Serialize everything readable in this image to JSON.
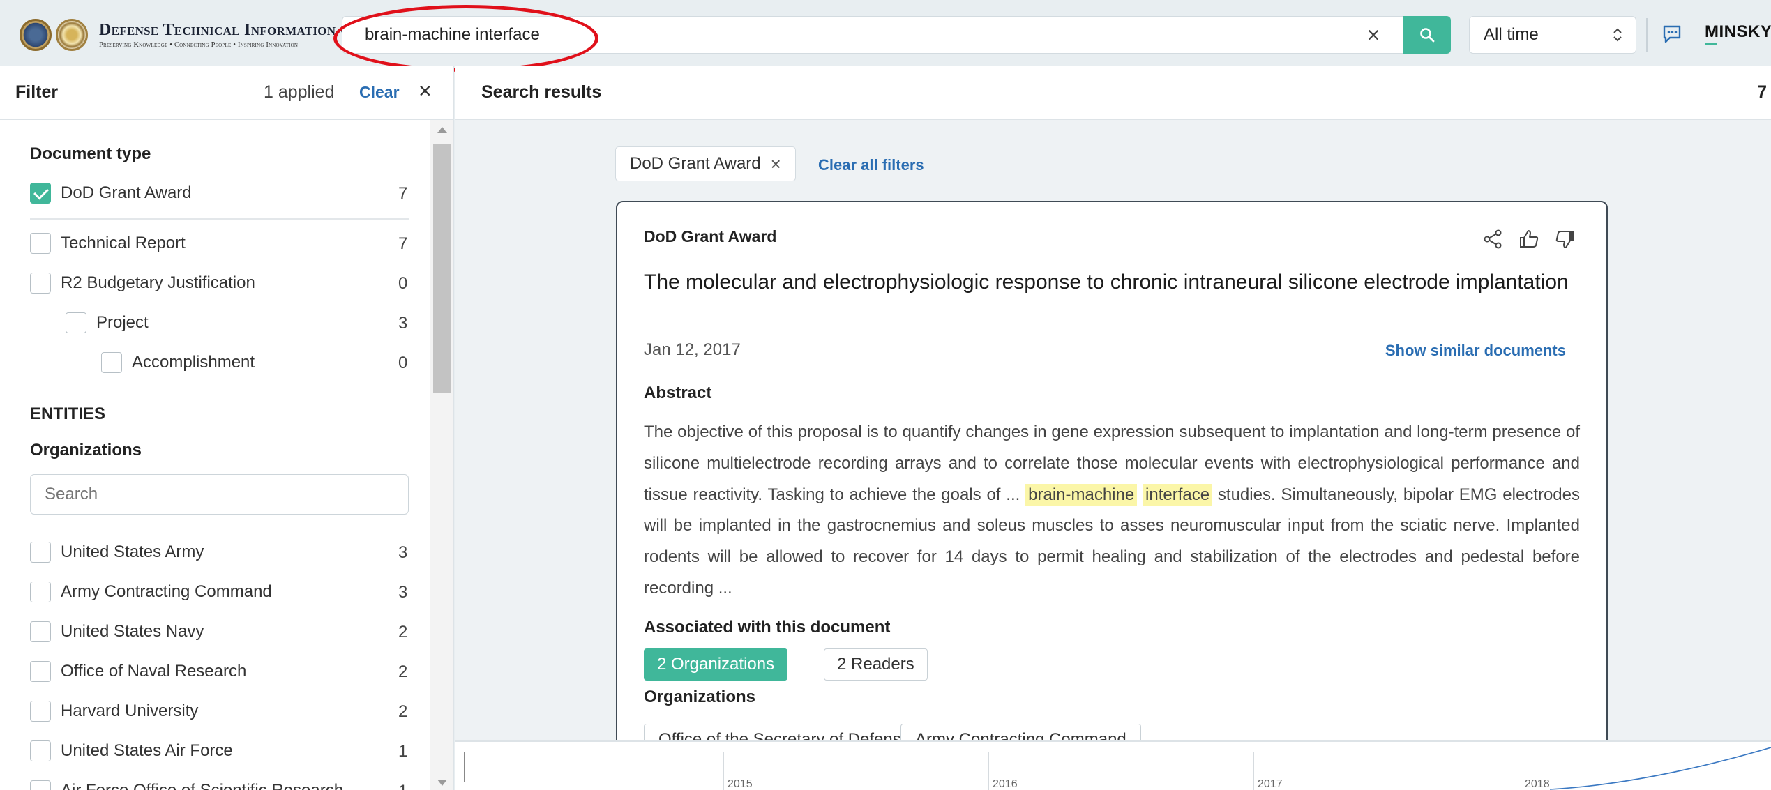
{
  "header": {
    "logo_title": "Defense Technical Information Center",
    "logo_subtitle": "Preserving Knowledge • Connecting People • Inspiring Innovation",
    "search_value": "brain-machine interface",
    "time_filter": "All time",
    "brand": "MINSKY",
    "accent_color": "#40b79a",
    "highlight_color": "#e0101a"
  },
  "filter": {
    "title": "Filter",
    "applied": "1 applied",
    "clear_label": "Clear",
    "document_type_title": "Document type",
    "document_types": [
      {
        "label": "DoD Grant Award",
        "count": "7",
        "checked": true
      },
      {
        "label": "Technical Report",
        "count": "7",
        "checked": false
      },
      {
        "label": "R2 Budgetary Justification",
        "count": "0",
        "checked": false
      },
      {
        "label": "Project",
        "count": "3",
        "checked": false
      },
      {
        "label": "Accomplishment",
        "count": "0",
        "checked": false
      }
    ],
    "entities_title": "ENTITIES",
    "organizations_title": "Organizations",
    "org_search_placeholder": "Search",
    "organizations": [
      {
        "label": "United States Army",
        "count": "3"
      },
      {
        "label": "Army Contracting Command",
        "count": "3"
      },
      {
        "label": "United States Navy",
        "count": "2"
      },
      {
        "label": "Office of Naval Research",
        "count": "2"
      },
      {
        "label": "Harvard University",
        "count": "2"
      },
      {
        "label": "United States Air Force",
        "count": "1"
      },
      {
        "label": "Air Force Office of Scientific Research",
        "count": "1"
      }
    ]
  },
  "results": {
    "title": "Search results",
    "count": "7",
    "active_chip": "DoD Grant Award",
    "clear_all_label": "Clear all filters",
    "card": {
      "doc_type": "DoD Grant Award",
      "title": "The molecular and electrophysiologic response to chronic intraneural silicone electrode implantation",
      "date": "Jan 12, 2017",
      "similar_label": "Show similar documents",
      "abstract_heading": "Abstract",
      "abstract_before": "The objective of this proposal is to quantify changes in gene expression subsequent to implantation and long-term presence of silicone multielectrode recording arrays and to correlate those molecular events with electrophysiological performance and tissue reactivity. Tasking to achieve the goals of ... ",
      "abstract_hl1": "brain-machine",
      "abstract_hl2": "interface",
      "abstract_after": " studies. Simultaneously, bipolar EMG electrodes will be implanted in the gastrocnemius and soleus muscles to asses neuromuscular input from the sciatic nerve. Implanted rodents will be allowed to recover for 14 days to permit healing and stabilization of the electrodes and pedestal before recording ...",
      "assoc_heading": "Associated with this document",
      "tab_orgs": "2 Organizations",
      "tab_readers": "2 Readers",
      "orgs_heading": "Organizations",
      "org_tags": [
        "Office of the Secretary of Defense",
        "Army Contracting Command"
      ]
    }
  },
  "timeline": {
    "years": [
      "2015",
      "2016",
      "2017",
      "2018"
    ]
  }
}
